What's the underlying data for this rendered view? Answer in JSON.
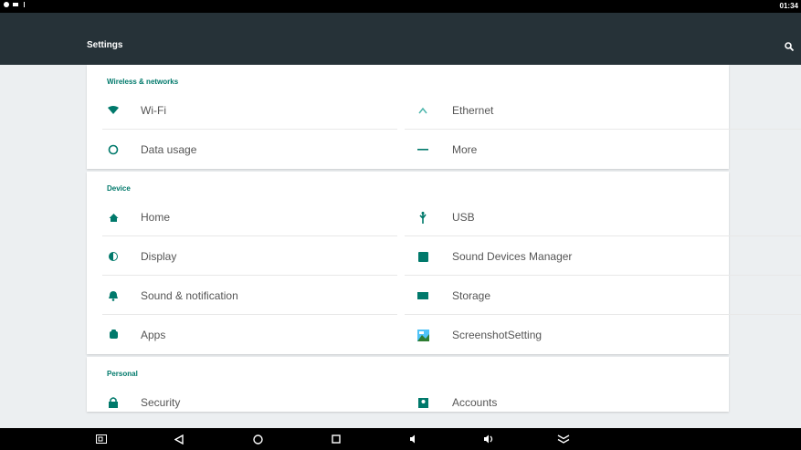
{
  "status": {
    "time": "01:34"
  },
  "appbar": {
    "title": "Settings"
  },
  "sections": {
    "wireless": {
      "header": "Wireless & networks",
      "wifi": "Wi-Fi",
      "ethernet": "Ethernet",
      "data_usage": "Data usage",
      "more": "More"
    },
    "device": {
      "header": "Device",
      "home": "Home",
      "usb": "USB",
      "display": "Display",
      "sound_devices": "Sound Devices Manager",
      "sound_notification": "Sound & notification",
      "storage": "Storage",
      "apps": "Apps",
      "screenshot": "ScreenshotSetting"
    },
    "personal": {
      "header": "Personal",
      "security": "Security",
      "accounts": "Accounts"
    }
  },
  "colors": {
    "accent": "#009688",
    "header": "#00796b",
    "appbar": "#263238"
  }
}
